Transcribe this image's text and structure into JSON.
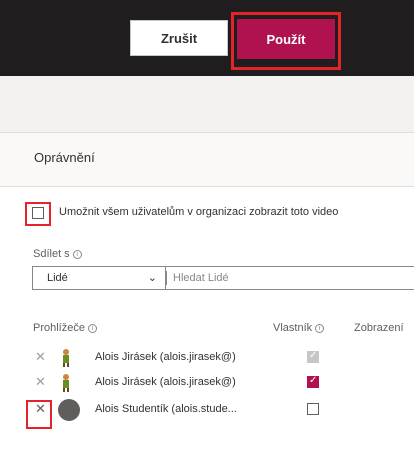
{
  "toolbar": {
    "cancel_label": "Zrušit",
    "apply_label": "Použít",
    "apply_color": "#b0124f"
  },
  "permissions": {
    "title": "Oprávnění",
    "allow_all_label": "Umožnit všem uživatelům v organizaci zobrazit toto video",
    "allow_all_checked": false
  },
  "share": {
    "label": "Sdílet s",
    "dropdown_value": "Lidé",
    "search_placeholder": "Hledat Lidé"
  },
  "columns": {
    "viewers": "Prohlížeče",
    "owner": "Vlastník",
    "view": "Zobrazení"
  },
  "users": [
    {
      "name": "Alois Jirásek (alois.jirasek@)",
      "owner": "disabled",
      "avatar": "person-figure-icon"
    },
    {
      "name": "Alois Jirásek (alois.jirasek@)",
      "owner": "checked",
      "avatar": "person-figure-icon"
    },
    {
      "name": "Alois Studentík (alois.stude...",
      "owner": "unchecked",
      "avatar": "generic-avatar-icon"
    }
  ],
  "icons": {
    "info": "info-icon",
    "chevron": "chevron-down-icon",
    "remove": "close-icon"
  }
}
